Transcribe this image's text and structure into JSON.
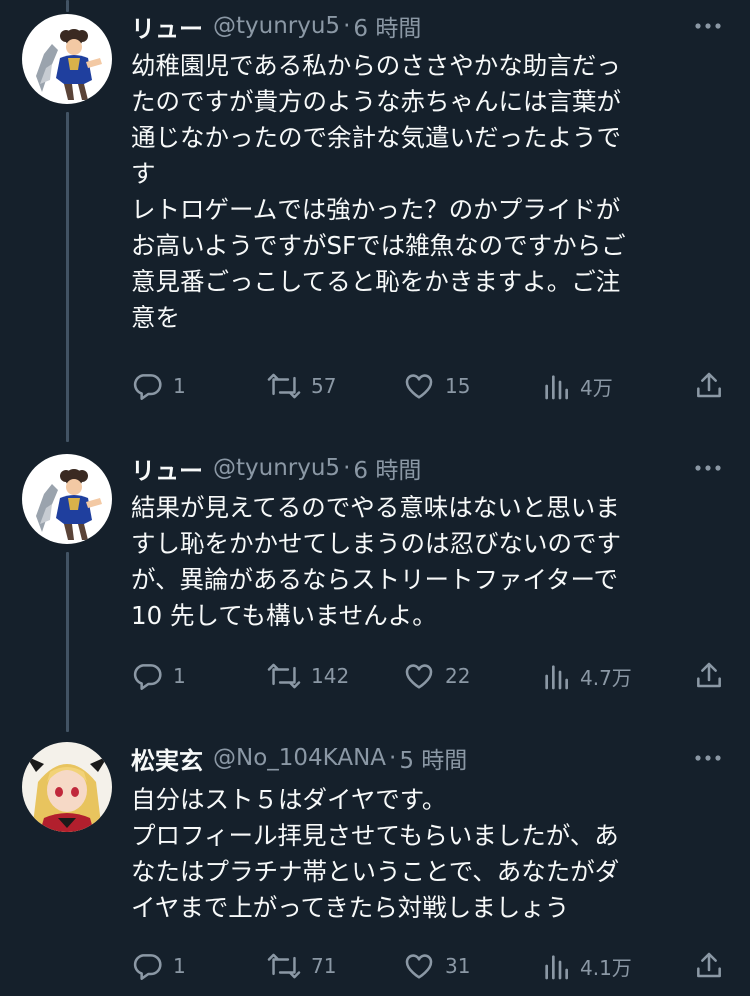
{
  "colors": {
    "background": "#15202b",
    "text_primary": "#f7f9f9",
    "text_secondary": "#8b98a5",
    "thread_line": "#425364"
  },
  "tweets": [
    {
      "name": "リュー",
      "handle": "@tyunryu5",
      "separator": "·",
      "time": "6 時間",
      "avatar_icon": "chun-li-avatar",
      "lines": [
        "幼稚園児である私からのささやかな助言だっ",
        "たのですが貴方のような赤ちゃんには言葉が",
        "通じなかったので余計な気遣いだったようで",
        "す",
        "レトロゲームでは強かった？のかプライドが",
        "お高いようですがSFでは雑魚なのですからご",
        "意見番ごっこしてると恥をかきますよ。ご注",
        "意を"
      ],
      "replies": "1",
      "retweets": "57",
      "likes": "15",
      "views": "4万"
    },
    {
      "name": "リュー",
      "handle": "@tyunryu5",
      "separator": "·",
      "time": "6 時間",
      "avatar_icon": "chun-li-avatar",
      "lines": [
        "結果が見えてるのでやる意味はないと思いま",
        "すし恥をかかせてしまうのは忍びないのです",
        "が、異論があるならストリートファイターで",
        "10 先しても構いませんよ。"
      ],
      "replies": "1",
      "retweets": "142",
      "likes": "22",
      "views": "4.7万"
    },
    {
      "name": "松実玄",
      "handle": "@No_104KANA",
      "separator": "·",
      "time": "5 時間",
      "avatar_icon": "anime-girl-avatar",
      "lines": [
        "自分はスト５はダイヤです。",
        "プロフィール拝見させてもらいましたが、あ",
        "なたはプラチナ帯ということで、あなたがダ",
        "イヤまで上がってきたら対戦しましょう"
      ],
      "replies": "1",
      "retweets": "71",
      "likes": "31",
      "views": "4.1万"
    }
  ]
}
